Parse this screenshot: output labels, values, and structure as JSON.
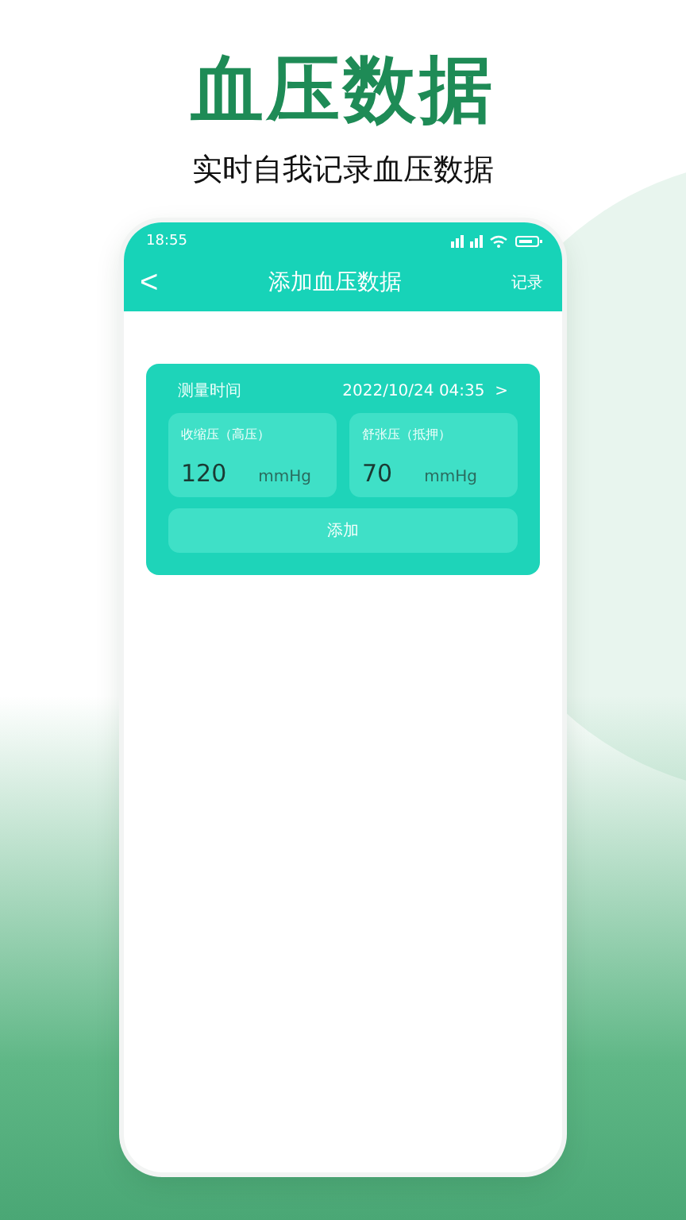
{
  "headline": "血压数据",
  "subtitle": "实时自我记录血压数据",
  "status_bar": {
    "time": "18:55"
  },
  "nav": {
    "back": "<",
    "title": "添加血压数据",
    "action": "记录"
  },
  "form": {
    "time_label": "测量时间",
    "time_value": "2022/10/24 04:35",
    "chevron": ">",
    "fields": [
      {
        "label": "收缩压（高压）",
        "value": "120",
        "unit": "mmHg"
      },
      {
        "label": "舒张压（抵押）",
        "value": "70",
        "unit": "mmHg"
      }
    ],
    "submit": "添加"
  }
}
